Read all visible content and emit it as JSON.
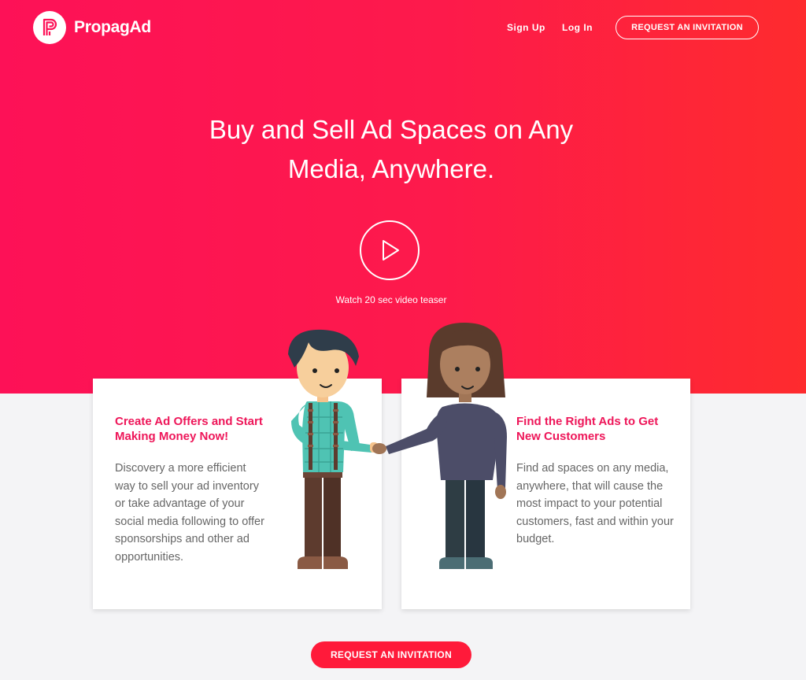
{
  "brand": {
    "name": "PropagAd"
  },
  "nav": {
    "signup": "Sign Up",
    "login": "Log In",
    "cta": "REQUEST AN INVITATION"
  },
  "hero": {
    "headline": "Buy and Sell Ad Spaces on Any Media, Anywhere.",
    "video_caption": "Watch 20 sec video teaser"
  },
  "cards": [
    {
      "title": "Create Ad Offers and Start Making Money Now!",
      "text": "Discovery a more efficient way to sell your ad inventory or take advantage of your social media following to offer sponsorships and other ad opportunities."
    },
    {
      "title": "Find the Right Ads to Get New Customers",
      "text": "Find ad spaces on any media, anywhere, that will cause the most impact to your potential customers, fast and within your budget."
    }
  ],
  "footer_cta": "REQUEST AN INVITATION",
  "colors": {
    "accent": "#fd1157",
    "accent_end": "#fe2b2e",
    "card_title": "#ee1659",
    "page_bg": "#f4f4f6"
  },
  "icons": [
    "propagad-logo-icon",
    "play-icon",
    "people-illustration"
  ]
}
